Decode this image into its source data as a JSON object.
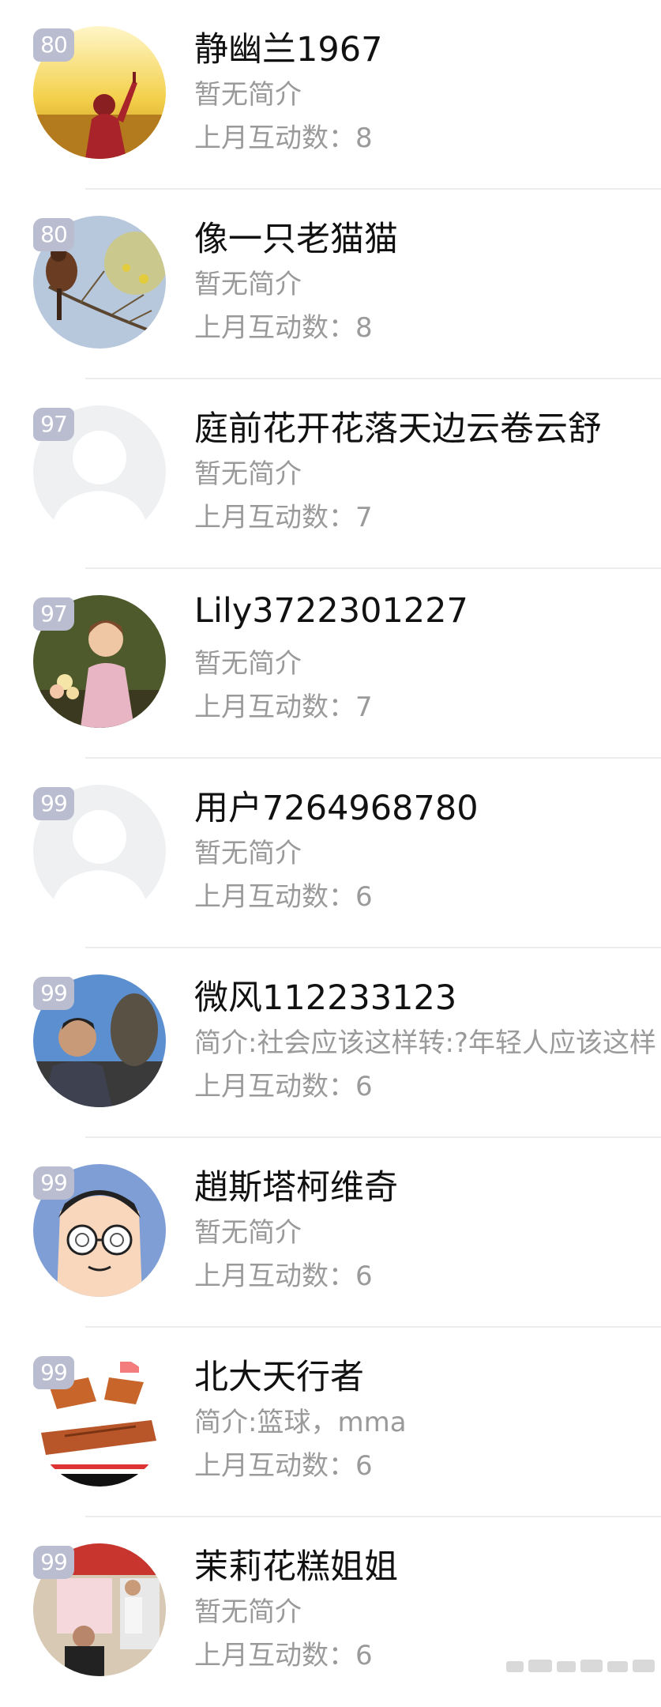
{
  "colors": {
    "badge": "#b9bdcf",
    "name": "#111111",
    "secondary": "#9a9a9a",
    "divider": "#ececec"
  },
  "users": [
    {
      "level": "80",
      "name": "静幽兰1967",
      "bio": "暂无简介",
      "stat": "上月互动数：8",
      "avatar": "avatar-sunset-woman"
    },
    {
      "level": "80",
      "name": "像一只老猫猫",
      "bio": "暂无简介",
      "stat": "上月互动数：8",
      "avatar": "avatar-bird-branch"
    },
    {
      "level": "97",
      "name": "庭前花开花落天边云卷云舒",
      "bio": "暂无简介",
      "stat": "上月互动数：7",
      "avatar": "avatar-default"
    },
    {
      "level": "97",
      "name": "Lily3722301227",
      "bio": "暂无简介",
      "stat": "上月互动数：7",
      "avatar": "avatar-girl-flowers"
    },
    {
      "level": "99",
      "name": "用户7264968780",
      "bio": "暂无简介",
      "stat": "上月互动数：6",
      "avatar": "avatar-default"
    },
    {
      "level": "99",
      "name": "微风112233123",
      "bio": "简介:社会应该这样转:?年轻人应该这样",
      "stat": "上月互动数：6",
      "avatar": "avatar-man-statue"
    },
    {
      "level": "99",
      "name": "趙斯塔柯维奇",
      "bio": "暂无简介",
      "stat": "上月互动数：6",
      "avatar": "avatar-cartoon-glasses"
    },
    {
      "level": "99",
      "name": "北大天行者",
      "bio": "简介:篮球，mma",
      "stat": "上月互动数：6",
      "avatar": "avatar-diagram"
    },
    {
      "level": "99",
      "name": "茉莉花糕姐姐",
      "bio": "暂无简介",
      "stat": "上月互动数：6",
      "avatar": "avatar-shop-photo"
    }
  ]
}
